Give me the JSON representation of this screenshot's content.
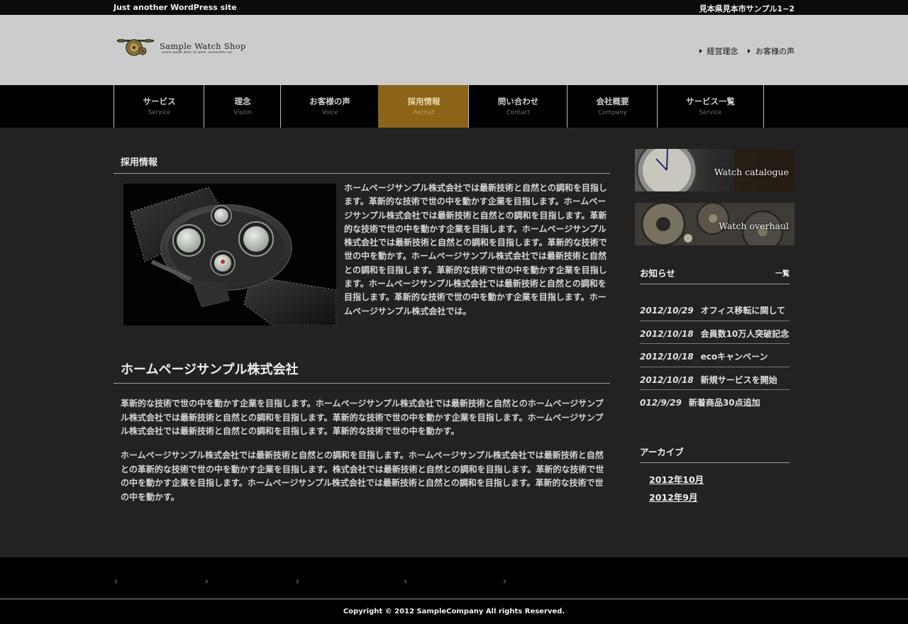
{
  "topbar": {
    "tagline": "Just another WordPress site",
    "address": "見本県見本市サンプル1−2"
  },
  "header": {
    "logo_name": "Sample Watch Shop",
    "logo_sub": "Lorem ipsum dolor sit amet, consectetur ad",
    "links": [
      {
        "label": "経営理念"
      },
      {
        "label": "お客様の声"
      }
    ]
  },
  "nav": {
    "items": [
      {
        "jp": "サービス",
        "en": "Service",
        "active": false
      },
      {
        "jp": "理念",
        "en": "Vision",
        "active": false
      },
      {
        "jp": "お客様の声",
        "en": "Voice",
        "active": false
      },
      {
        "jp": "採用情報",
        "en": "Recruit",
        "active": true
      },
      {
        "jp": "問い合わせ",
        "en": "Contact",
        "active": false
      },
      {
        "jp": "会社概要",
        "en": "Company",
        "active": false
      },
      {
        "jp": "サービス一覧",
        "en": "Service",
        "active": false
      }
    ]
  },
  "main": {
    "section_title": "採用情報",
    "intro": "ホームページサンプル株式会社では最新技術と自然との調和を目指します。革新的な技術で世の中を動かす企業を目指します。ホームページサンプル株式会社では最新技術と自然との調和を目指します。革新的な技術で世の中を動かす企業を目指します。ホームページサンプル株式会社では最新技術と自然との調和を目指します。革新的な技術で世の中を動かす。ホームページサンプル株式会社では最新技術と自然との調和を目指します。革新的な技術で世の中を動かす企業を目指します。ホームページサンプル株式会社では最新技術と自然との調和を目指します。革新的な技術で世の中を動かす企業を目指します。ホームページサンプル株式会社では。",
    "company_heading": "ホームページサンプル株式会社",
    "para1": "革新的な技術で世の中を動かす企業を目指します。ホームページサンプル株式会社では最新技術と自然とのホームページサンプル株式会社では最新技術と自然との調和を目指します。革新的な技術で世の中を動かす企業を目指します。ホームページサンプル株式会社では最新技術と自然との調和を目指します。革新的な技術で世の中を動かす。",
    "para2": "ホームページサンプル株式会社では最新技術と自然との調和を目指します。ホームページサンプル株式会社では最新技術と自然との革新的な技術で世の中を動かす企業を目指します。株式会社では最新技術と自然との調和を目指します。革新的な技術で世の中を動かす企業を目指します。ホームページサンプル株式会社では最新技術と自然との調和を目指します。革新的な技術で世の中を動かす。"
  },
  "sidebar": {
    "banner1": "Watch catalogue",
    "banner2": "Watch overhaul",
    "news_title": "お知らせ",
    "news_all": "一覧",
    "news": [
      {
        "date": "2012/10/29",
        "title": "オフィス移転に関して"
      },
      {
        "date": "2012/10/18",
        "title": "会員数10万人突破記念"
      },
      {
        "date": "2012/10/18",
        "title": "ecoキャンペーン"
      },
      {
        "date": "2012/10/18",
        "title": "新規サービスを開始"
      },
      {
        "date": "012/9/29",
        "title": "新着商品30点追加"
      }
    ],
    "archive_title": "アーカイブ",
    "archive": [
      {
        "label": "2012年10月"
      },
      {
        "label": "2012年9月"
      }
    ]
  },
  "footer": {
    "copyright": "Copyright © 2012 SampleCompany All rights Reserved."
  },
  "colors": {
    "page_bg": "#222222",
    "header_bg": "#cccccc",
    "nav_active": "#8c6418"
  }
}
